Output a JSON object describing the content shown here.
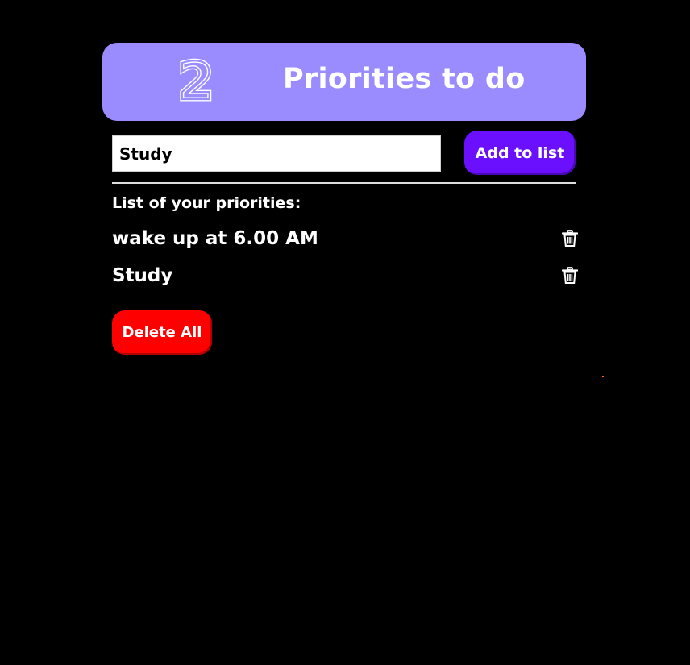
{
  "header": {
    "count": "2",
    "title": "Priorities to do",
    "background_color": "#9a8cff"
  },
  "form": {
    "input_value": "Study",
    "add_button_label": "Add to list",
    "add_button_color": "#6a10ff"
  },
  "list": {
    "heading": "List of your priorities:",
    "items": [
      {
        "text": "wake up at 6.00 AM",
        "icon": "trash-icon"
      },
      {
        "text": "Study",
        "icon": "trash-icon"
      }
    ]
  },
  "actions": {
    "delete_all_label": "Delete All",
    "delete_all_color": "#ff0000"
  }
}
